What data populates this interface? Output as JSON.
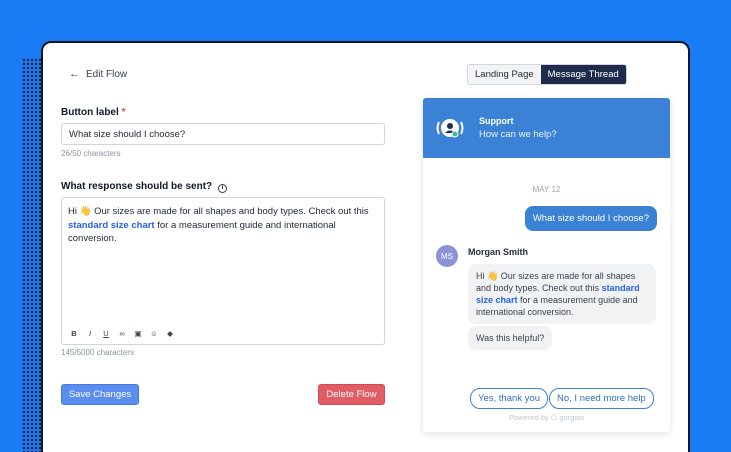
{
  "editor_panel": {
    "back_label": "Edit Flow",
    "button_label_title": "Button label",
    "required_mark": "*",
    "button_label_value": "What size should I choose?",
    "button_label_count": "26/50 characters",
    "response_title": "What response should be sent?",
    "response_text_before": "Hi 👋 Our sizes are made for all shapes and body types. Check out this ",
    "response_link": "standard size chart",
    "response_text_after": " for a measurement guide and international conversion.",
    "response_count": "145/5000 characters",
    "toolbar_icons": [
      "bold-icon",
      "italic-icon",
      "underline-icon",
      "link-icon",
      "image-icon",
      "emoji-icon",
      "attachment-icon"
    ],
    "toolbar_glyphs": [
      "B",
      "I",
      "U",
      "∞",
      "▣",
      "☺",
      "◆"
    ],
    "save_label": "Save Changes",
    "delete_label": "Delete Flow"
  },
  "preview_tabs": [
    {
      "label": "Landing Page",
      "active": false
    },
    {
      "label": "Message Thread",
      "active": true
    }
  ],
  "chat": {
    "header_title": "Support",
    "header_subtitle": "How can we help?",
    "date": "MAY 12",
    "customer_message": "What size should I choose?",
    "agent_initials": "MS",
    "agent_name": "Morgan Smith",
    "agent_text_before": "Hi 👋 Our sizes are made for all shapes and body types. Check out this ",
    "agent_link": "standard size chart",
    "agent_text_after": " for a measurement guide and international conversion.",
    "followup": "Was this helpful?",
    "quick_reply_yes": "Yes, thank you",
    "quick_reply_no": "No, I need more help",
    "powered_by": "Powered by ⎔ gorgias"
  },
  "colors": {
    "background": "#1a7cf5",
    "chat_header": "#3b82d6",
    "save_button": "#5b8def",
    "delete_button": "#e25c66",
    "active_tab": "#1e2b4a"
  }
}
